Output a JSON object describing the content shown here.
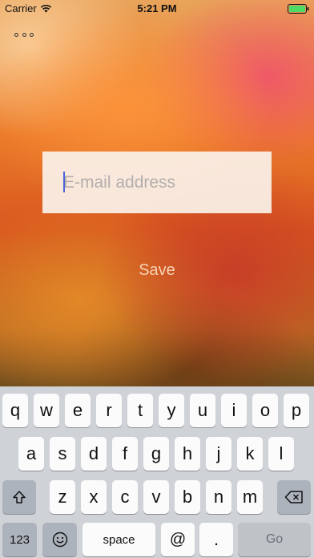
{
  "status_bar": {
    "carrier": "Carrier",
    "time": "5:21 PM",
    "icons": [
      "wifi-icon",
      "battery-icon"
    ]
  },
  "toolbar": {
    "menu_icon": "more-dots-icon"
  },
  "email_field": {
    "placeholder": "E-mail address",
    "value": ""
  },
  "save_label": "Save",
  "colors": {
    "field_background": "#faf1e8",
    "save_text": "#f6d2b6",
    "caret": "#4a62d8",
    "keyboard_background": "#cfd2d6"
  },
  "keyboard": {
    "row1": [
      "q",
      "w",
      "e",
      "r",
      "t",
      "y",
      "u",
      "i",
      "o",
      "p"
    ],
    "row2": [
      "a",
      "s",
      "d",
      "f",
      "g",
      "h",
      "j",
      "k",
      "l"
    ],
    "row3": [
      "z",
      "x",
      "c",
      "v",
      "b",
      "n",
      "m"
    ],
    "shift_icon": "shift-icon",
    "delete_icon": "backspace-icon",
    "numbers_label": "123",
    "emoji_icon": "emoji-icon",
    "space_label": "space",
    "at_label": "@",
    "dot_label": ".",
    "go_label": "Go"
  }
}
